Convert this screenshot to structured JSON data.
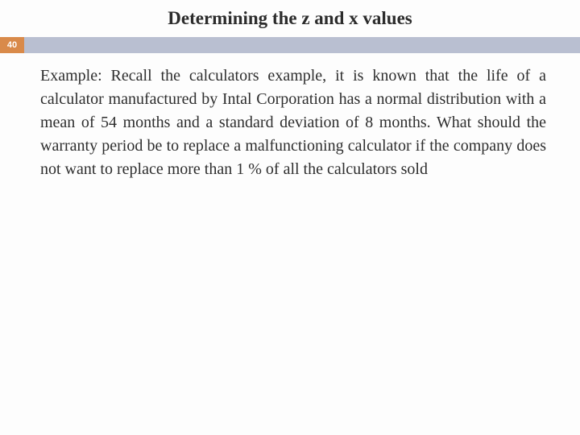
{
  "slide": {
    "title": "Determining the z and x values",
    "page_number": "40",
    "body": "Example: Recall the calculators example, it is known that the life of a calculator manufactured by Intal Corporation has a normal distribution with a mean of 54 months and a standard deviation of 8 months. What should the warranty period be to replace a malfunctioning calculator if the company does not want to replace more than 1 % of all the calculators sold"
  }
}
